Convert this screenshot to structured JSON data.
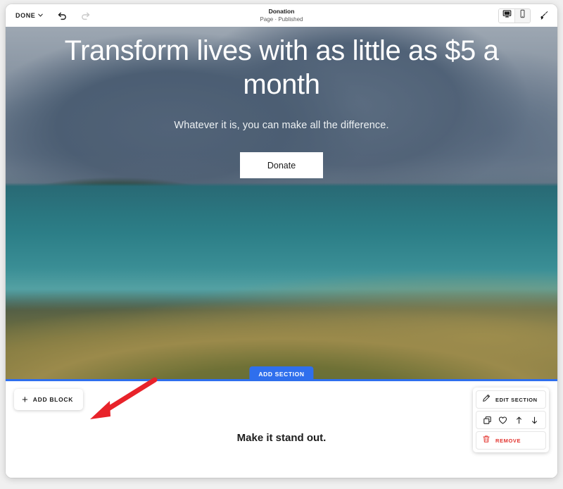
{
  "toolbar": {
    "done_label": "DONE",
    "chevron": "⌄",
    "undo_icon": "undo-icon",
    "redo_icon": "redo-icon",
    "page_title": "Donation",
    "page_status": "Page · Published",
    "desktop_icon": "desktop-icon",
    "mobile_icon": "mobile-icon",
    "brush_icon": "paintbrush-icon",
    "active_viewport": "desktop"
  },
  "hero": {
    "title": "Transform lives with as little as $5 a month",
    "subtitle": "Whatever it is, you can make all the difference.",
    "cta_label": "Donate",
    "overlay_color": "#364e68",
    "add_section_label": "ADD SECTION",
    "divider_color": "#2f6fed"
  },
  "editor": {
    "add_block_label": "ADD BLOCK",
    "add_block_plus": "+",
    "section_tools": {
      "edit_label": "EDIT SECTION",
      "edit_icon": "pencil-icon",
      "remove_label": "REMOVE",
      "remove_icon": "trash-icon",
      "remove_color": "#e3342f",
      "actions": [
        {
          "icon": "duplicate-icon",
          "name": "duplicate"
        },
        {
          "icon": "heart-icon",
          "name": "favorite"
        },
        {
          "icon": "arrow-up-icon",
          "name": "move-up"
        },
        {
          "icon": "arrow-down-icon",
          "name": "move-down"
        }
      ]
    }
  },
  "second_section": {
    "heading": "Make it stand out."
  },
  "annotation": {
    "arrow_color": "#e8232a",
    "points_to": "ADD BLOCK"
  }
}
